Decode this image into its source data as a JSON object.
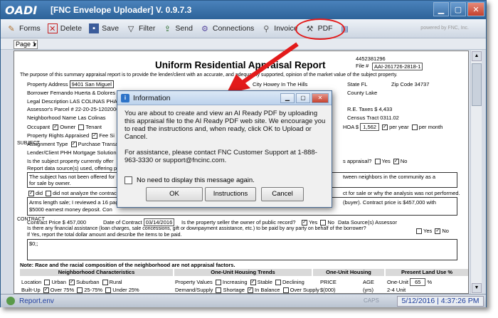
{
  "window": {
    "logo": "OADI",
    "title": "[FNC Envelope Uploader] V. 0.9.7.3"
  },
  "toolbar": {
    "items": [
      {
        "label": "Forms",
        "icon": "pencil-icon"
      },
      {
        "label": "Delete",
        "icon": "delete-x-icon"
      },
      {
        "label": "Save",
        "icon": "disk-icon"
      },
      {
        "label": "Filter",
        "icon": "funnel-icon"
      },
      {
        "label": "Send",
        "icon": "send-icon"
      },
      {
        "label": "Connections",
        "icon": "connections-icon"
      },
      {
        "label": "Invoice",
        "icon": "paperclip-icon"
      },
      {
        "label": "PDF",
        "icon": "pdf-icon"
      }
    ],
    "powered": "powered by FNC, Inc."
  },
  "page_select": {
    "value": "Page 1"
  },
  "document": {
    "title": "Uniform Residential Appraisal Report",
    "ref_no": "4452381296",
    "file_no_label": "File #",
    "file_no": "AAI-261726-2818-1",
    "purpose": "The purpose of this summary appraisal report is to provide the lender/client with an accurate, and adequately supported, opinion of the market value of the subject property.",
    "property_address_label": "Property Address",
    "property_address": "9401 San Miguel",
    "city_label": "City",
    "city": "Howey In The Hills",
    "state_label": "State",
    "state": "FL",
    "zip_label": "Zip Code",
    "zip": "34737",
    "borrower_label": "Borrower",
    "borrower": "Fernando Huerta & Dolores",
    "county_label": "County",
    "county": "Lake",
    "legal_label": "Legal Description",
    "legal": "LAS COLINAS PHA",
    "parcel_label": "Assessor's Parcel #",
    "parcel": "22-20-25-1202000",
    "taxes_label": "R.E. Taxes $",
    "taxes": "4,433",
    "neighborhood_label": "Neighborhood Name",
    "neighborhood": "Las Colinas",
    "census_label": "Census Tract",
    "census": "0311.02",
    "occupant_label": "Occupant",
    "owner_label": "Owner",
    "tenant_label": "Tenant",
    "hoa_label": "HOA $",
    "hoa": "1,562",
    "per_year": "per year",
    "per_month": "per month",
    "rights_label": "Property Rights Appraised",
    "fee_label": "Fee Si",
    "assignment_label": "Assignment Type",
    "assignment": "Purchase Transa",
    "lender_label": "Lender/Client",
    "lender": "PHH Mortgage Solution",
    "currently_offered": "Is the subject property currently offer",
    "report_sources": "Report data source(s) used, offering p",
    "appraisal_q": "s appraisal?",
    "yes": "Yes",
    "no": "No",
    "offered_text": "The subject has not been offered for",
    "offered_text2": "for sale by owner.",
    "between_neighbors": "tween neighbors in the community as a",
    "did_label": "did",
    "did_not_label": "did not analyze the contract",
    "not_performed": "ct for sale or why the analysis was not performed.",
    "arms_length": "Arms length sale; I reviewed a 16 pag",
    "earnest": "$5000 earnest money deposit. Con",
    "buyer_text": "(buyer).  Contract price is $457,000 with",
    "contract_price_label": "Contract Price $",
    "contract_price": "457,000",
    "date_contract_label": "Date of Contract",
    "date_contract": "03/14/2016",
    "seller_owner": "Is the property seller the owner of public record?",
    "data_sources_label": "Data Source(s)",
    "data_sources": "Assessor",
    "financial_assist": "Is there any financial assistance (loan charges, sale concessions, gift or downpayment assistance, etc.) to be paid by any party on behalf of the borrower?",
    "financial_assist2": "If Yes, report the total dollar amount and describe the items to be paid.",
    "amount": "$0;;",
    "race_note": "Note: Race and the racial composition of the neighborhood are not appraisal factors.",
    "nbhd_char": "Neighborhood Characteristics",
    "one_unit_trends": "One-Unit Housing Trends",
    "one_unit_housing": "One-Unit Housing",
    "present_land": "Present Land Use %",
    "location_label": "Location",
    "urban": "Urban",
    "suburban": "Suburban",
    "rural": "Rural",
    "property_values": "Property Values",
    "increasing": "Increasing",
    "stable": "Stable",
    "declining": "Declining",
    "price": "PRICE",
    "age": "AGE",
    "one_unit": "One-Unit",
    "one_unit_pct": "65",
    "pct_sign": "%",
    "builtup": "Built-Up",
    "over75": "Over 75%",
    "25to75": "25-75%",
    "under25": "Under 25%",
    "demand": "Demand/Supply",
    "shortage": "Shortage",
    "in_balance": "In Balance",
    "over_supply": "Over Supply",
    "price_unit": "$(000)",
    "age_unit": "(yrs)",
    "two_four": "2-4 Unit",
    "side_subject": "SUBJECT",
    "side_contract": "CONTRACT"
  },
  "dialog": {
    "title": "Information",
    "message1": "You are about to create and view an AI Ready PDF by uploading this appraisal file to the AI Ready PDF web site.  We encourage you to read the instructions and, when ready, click OK to Upload or Cancel.",
    "message2": "For assistance, please contact FNC Customer Support at 1-888-963-3330 or support@fncinc.com.",
    "checkbox": "No need to display this message again.",
    "ok": "OK",
    "instructions": "Instructions",
    "cancel": "Cancel"
  },
  "status": {
    "file": "Report.env",
    "caps": "CAPS",
    "datetime": "5/12/2016 | 4:37:26 PM"
  },
  "colors": {
    "arrow": "#e31b1b",
    "titlebar": "#2d6399"
  }
}
